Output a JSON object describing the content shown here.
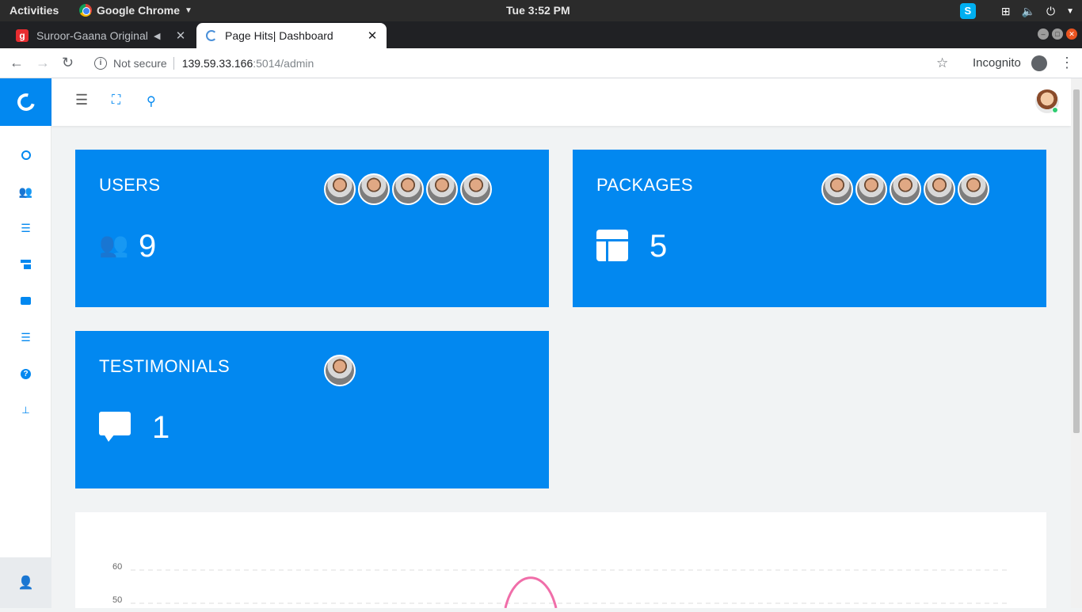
{
  "os": {
    "activities": "Activities",
    "app_name": "Google Chrome",
    "clock": "Tue  3:52 PM"
  },
  "browser": {
    "tabs": [
      {
        "title": "Suroor-Gaana Original",
        "active": false
      },
      {
        "title": "Page Hits| Dashboard",
        "active": true
      }
    ],
    "new_tab": "+",
    "security": "Not secure",
    "url_host": "139.59.33.166",
    "url_path": ":5014/admin",
    "incognito": "Incognito"
  },
  "sidebar": {
    "items": [
      "dashboard-icon",
      "users-icon",
      "list-icon",
      "packages-icon",
      "testimonials-icon",
      "list-icon-2",
      "help-icon",
      "sitemap-icon"
    ]
  },
  "cards": [
    {
      "title": "USERS",
      "value": "9",
      "icon": "users-icon",
      "avatars": 5
    },
    {
      "title": "PACKAGES",
      "value": "5",
      "icon": "table-icon",
      "avatars": 5
    },
    {
      "title": "TESTIMONIALS",
      "value": "1",
      "icon": "comment-icon",
      "avatars": 1
    }
  ],
  "chart_data": {
    "type": "line",
    "yticks": [
      "60",
      "50"
    ],
    "series_color": "#f06ea9",
    "accent": "#0288f0"
  }
}
